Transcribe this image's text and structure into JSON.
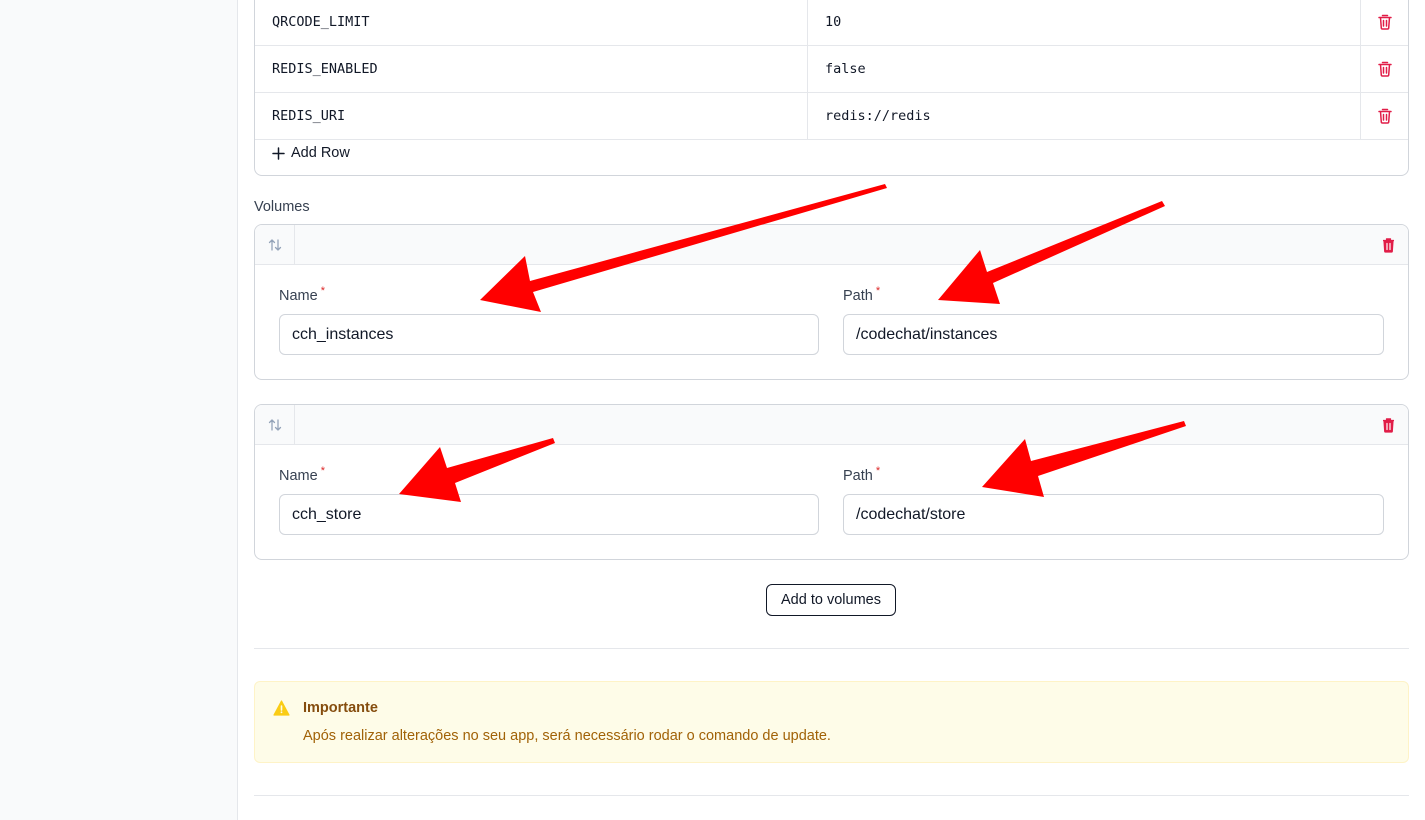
{
  "env": {
    "rows": [
      {
        "key": "QRCODE_LIMIT",
        "value": "10"
      },
      {
        "key": "REDIS_ENABLED",
        "value": "false"
      },
      {
        "key": "REDIS_URI",
        "value": "redis://redis"
      }
    ],
    "add_row_label": "Add Row"
  },
  "volumes": {
    "section_label": "Volumes",
    "items": [
      {
        "name_label": "Name",
        "name_value": "cch_instances",
        "path_label": "Path",
        "path_value": "/codechat/instances"
      },
      {
        "name_label": "Name",
        "name_value": "cch_store",
        "path_label": "Path",
        "path_value": "/codechat/store"
      }
    ],
    "required_marker": "*",
    "add_button_label": "Add to volumes"
  },
  "alert": {
    "title": "Importante",
    "message": "Após realizar alterações no seu app, será necessário rodar o comando de update."
  },
  "colors": {
    "danger": "#e11d48",
    "annotation_arrow": "#ff0000",
    "alert_bg": "#fefce8",
    "alert_icon": "#facc15"
  },
  "icons": {
    "delete": "trash-icon",
    "drag": "sort-arrows-icon",
    "add": "plus-icon",
    "warning": "warning-triangle-icon"
  }
}
